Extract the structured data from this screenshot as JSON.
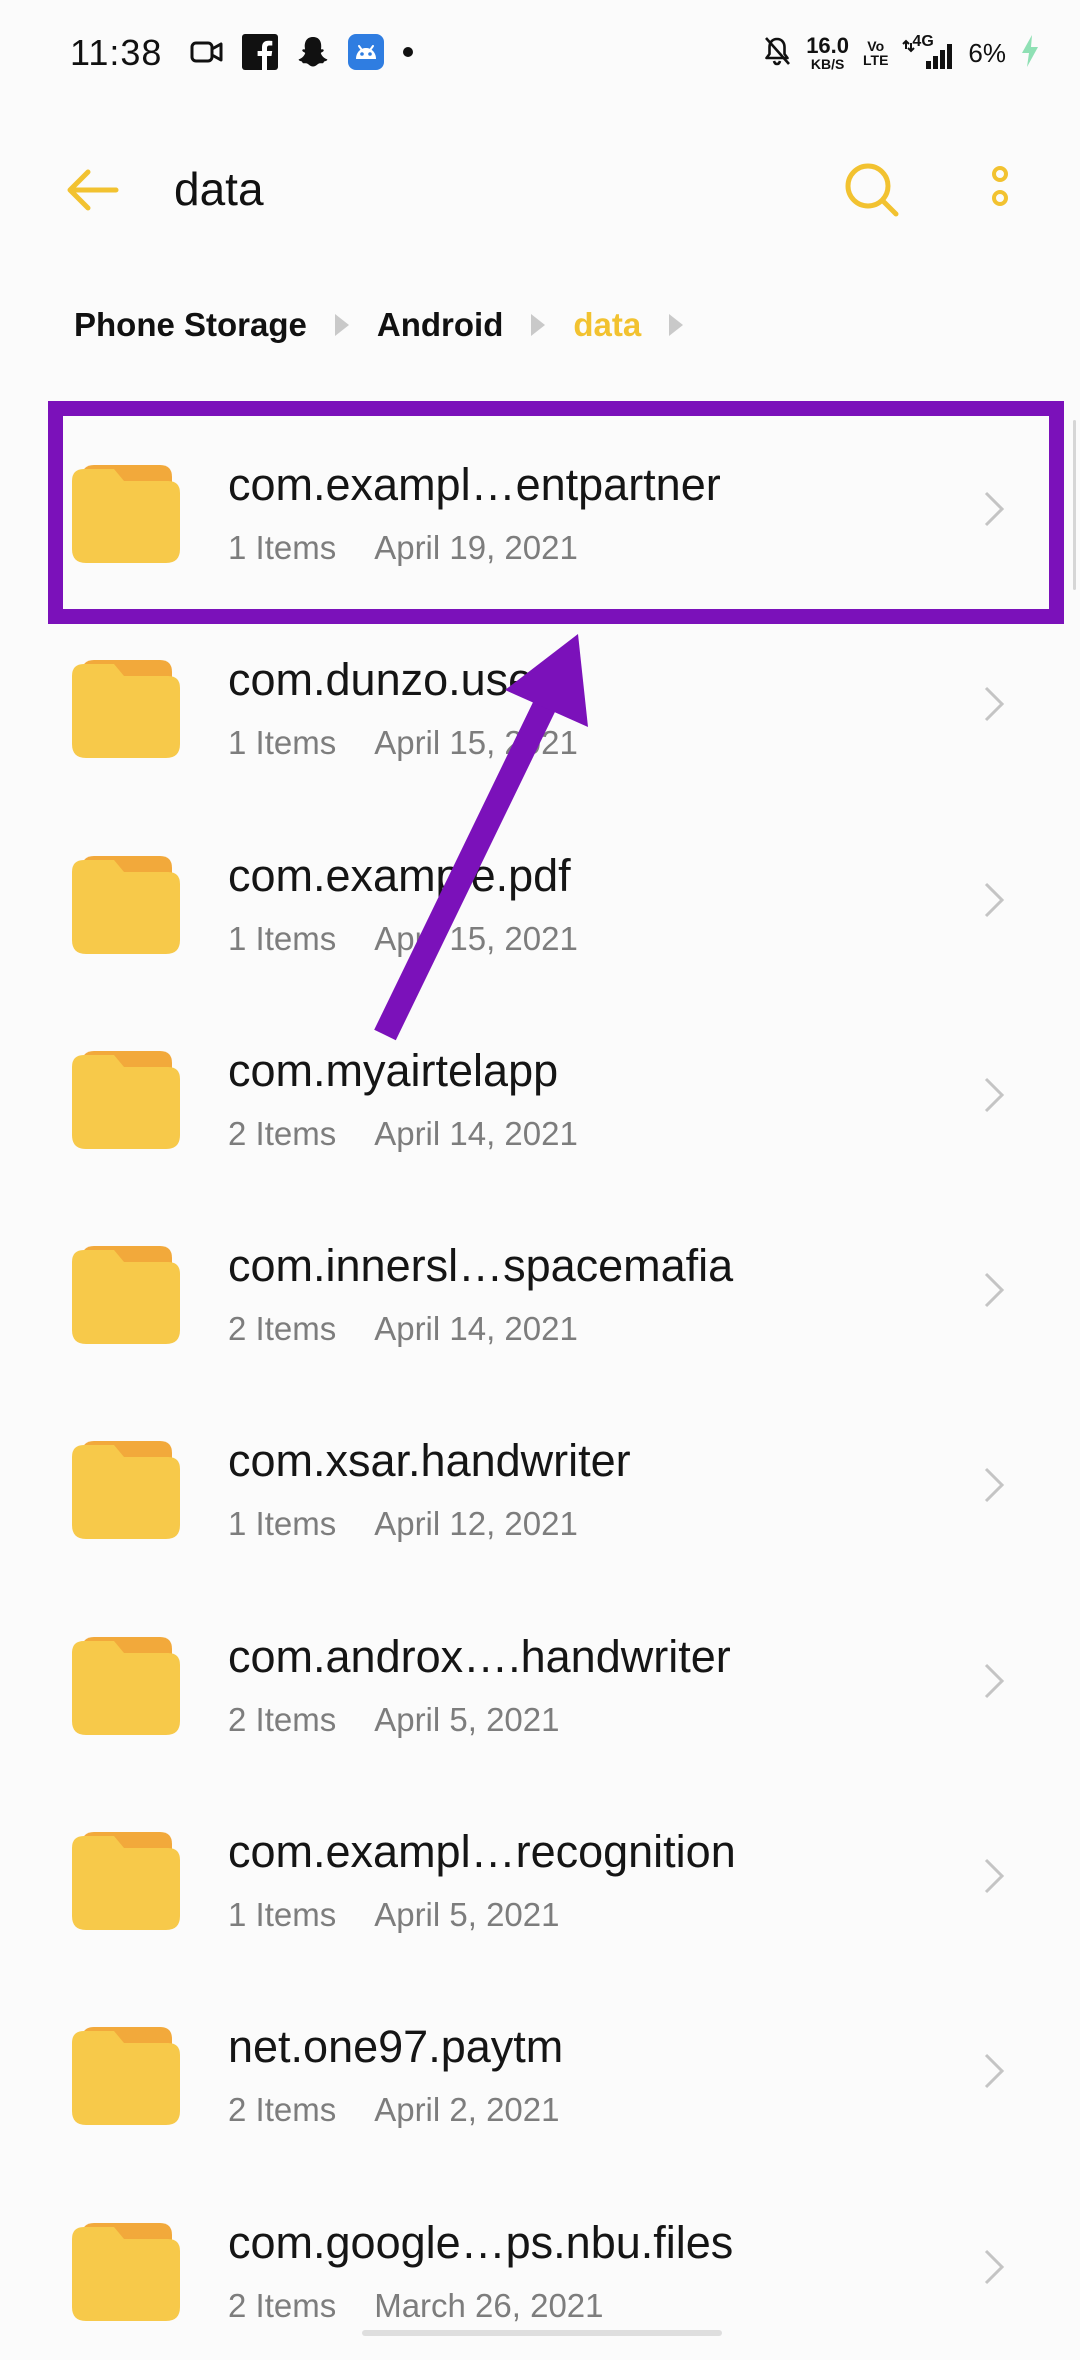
{
  "status_bar": {
    "time": "11:38",
    "left_icons": [
      "video-camera-icon",
      "facebook-icon",
      "snapchat-icon",
      "android-app-icon",
      "dot-icon"
    ],
    "net_speed_value": "16.0",
    "net_speed_unit": "KB/S",
    "volte_top": "Vo",
    "volte_bottom": "LTE",
    "network": "4G",
    "battery": "6%",
    "right_icons": [
      "mute-bell-icon",
      "signal-icon",
      "charging-bolt-icon"
    ]
  },
  "app_bar": {
    "title": "data",
    "back_icon": "back-arrow-icon",
    "search_icon": "search-icon",
    "more_icon": "more-vertical-icon"
  },
  "breadcrumb": {
    "items": [
      "Phone Storage",
      "Android",
      "data"
    ],
    "active_index": 2
  },
  "files": [
    {
      "name": "com.exampl…entpartner",
      "count": "1 Items",
      "date": "April 19, 2021"
    },
    {
      "name": "com.dunzo.user",
      "count": "1 Items",
      "date": "April 15, 2021"
    },
    {
      "name": "com.example.pdf",
      "count": "1 Items",
      "date": "April 15, 2021"
    },
    {
      "name": "com.myairtelapp",
      "count": "2 Items",
      "date": "April 14, 2021"
    },
    {
      "name": "com.innersl…spacemafia",
      "count": "2 Items",
      "date": "April 14, 2021"
    },
    {
      "name": "com.xsar.handwriter",
      "count": "1 Items",
      "date": "April 12, 2021"
    },
    {
      "name": "com.androx….handwriter",
      "count": "2 Items",
      "date": "April 5, 2021"
    },
    {
      "name": "com.exampl…recognition",
      "count": "1 Items",
      "date": "April 5, 2021"
    },
    {
      "name": "net.one97.paytm",
      "count": "2 Items",
      "date": "April 2, 2021"
    },
    {
      "name": "com.google…ps.nbu.files",
      "count": "2 Items",
      "date": "March 26, 2021"
    }
  ],
  "colors": {
    "accent": "#f2c230",
    "folder": "#f7c94a",
    "folder_tab": "#f2a93b",
    "annotation": "#7b11ba"
  },
  "annotation": {
    "highlighted_row_index": 0
  }
}
